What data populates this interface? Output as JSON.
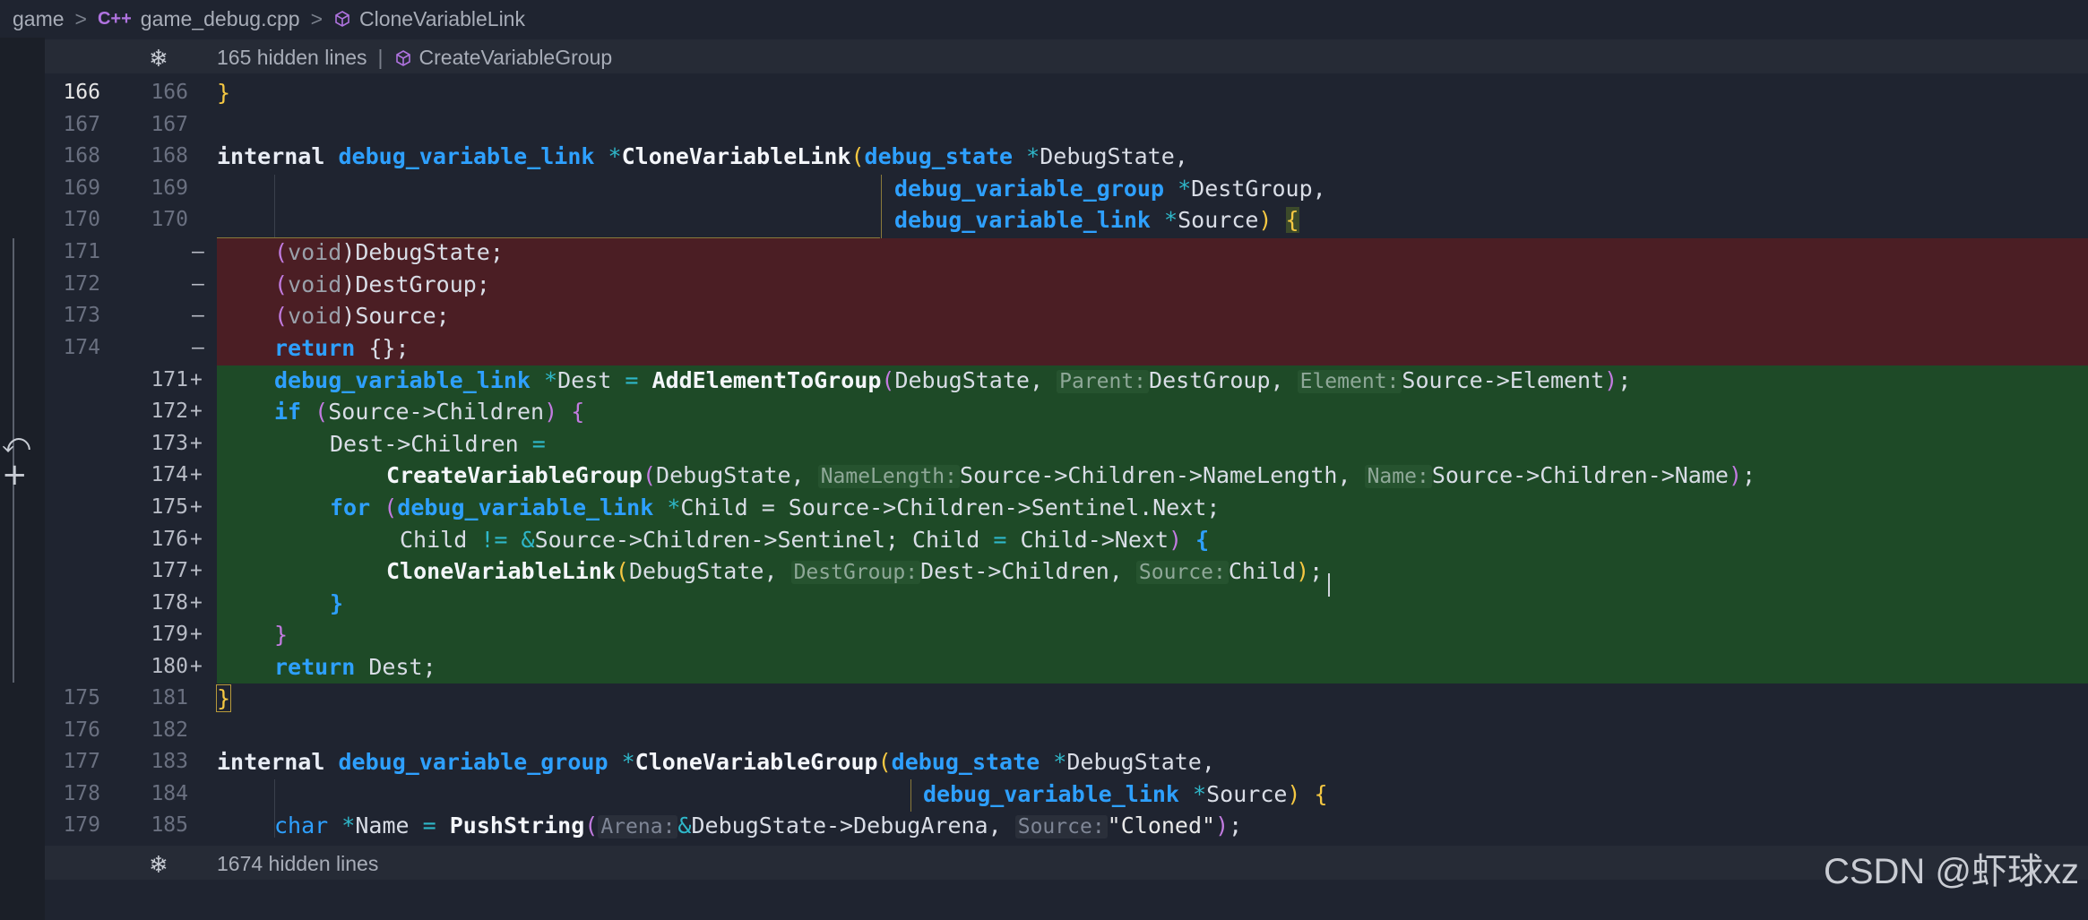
{
  "breadcrumb": {
    "root": "game",
    "cpp_icon": "C++",
    "file": "game_debug.cpp",
    "symbol": "CloneVariableLink"
  },
  "folds": {
    "top_text": "165 hidden lines",
    "top_symbol": "CreateVariableGroup",
    "bottom_text": "1674 hidden lines"
  },
  "lines": [
    {
      "l": "166",
      "r": "166",
      "m": ""
    },
    {
      "l": "167",
      "r": "167",
      "m": ""
    },
    {
      "l": "168",
      "r": "168",
      "m": ""
    },
    {
      "l": "169",
      "r": "169",
      "m": ""
    },
    {
      "l": "170",
      "r": "170",
      "m": ""
    },
    {
      "l": "171",
      "r": "",
      "m": "—"
    },
    {
      "l": "172",
      "r": "",
      "m": "—"
    },
    {
      "l": "173",
      "r": "",
      "m": "—"
    },
    {
      "l": "174",
      "r": "",
      "m": "—"
    },
    {
      "l": "",
      "r": "171",
      "m": "+"
    },
    {
      "l": "",
      "r": "172",
      "m": "+"
    },
    {
      "l": "",
      "r": "173",
      "m": "+"
    },
    {
      "l": "",
      "r": "174",
      "m": "+"
    },
    {
      "l": "",
      "r": "175",
      "m": "+"
    },
    {
      "l": "",
      "r": "176",
      "m": "+"
    },
    {
      "l": "",
      "r": "177",
      "m": "+"
    },
    {
      "l": "",
      "r": "178",
      "m": "+"
    },
    {
      "l": "",
      "r": "179",
      "m": "+"
    },
    {
      "l": "",
      "r": "180",
      "m": "+"
    },
    {
      "l": "175",
      "r": "181",
      "m": ""
    },
    {
      "l": "176",
      "r": "182",
      "m": ""
    },
    {
      "l": "177",
      "r": "183",
      "m": ""
    },
    {
      "l": "178",
      "r": "184",
      "m": ""
    },
    {
      "l": "179",
      "r": "185",
      "m": ""
    }
  ],
  "code": {
    "c0_brace": "}",
    "c2_internal": "internal",
    "c2_type": "debug_variable_link",
    "c2_star": "*",
    "c2_fn": "CloneVariableLink",
    "c2_open": "(",
    "c2_ptype": "debug_state",
    "c2_pstar": "*",
    "c2_pname": "DebugState,",
    "c3_ptype": "debug_variable_group",
    "c3_pstar": "*",
    "c3_pname": "DestGroup,",
    "c4_ptype": "debug_variable_link",
    "c4_pstar": "*",
    "c4_pname": "Source",
    "c4_close": ")",
    "c4_brace": "{",
    "d1_open": "(",
    "d1_void": "void",
    "d1_rest": ")DebugState;",
    "d2_open": "(",
    "d2_void": "void",
    "d2_rest": ")DestGroup;",
    "d3_open": "(",
    "d3_void": "void",
    "d3_rest": ")Source;",
    "d4_ret": "return",
    "d4_rest": "{};",
    "a1_type": "debug_variable_link",
    "a1_star": "*",
    "a1_var": "Dest",
    "a1_eq": "=",
    "a1_fn": "AddElementToGroup",
    "a1_open": "(",
    "a1_arg1": "DebugState,",
    "a1_h1": "Parent:",
    "a1_arg2": "DestGroup,",
    "a1_h2": "Element:",
    "a1_arg3": "Source->Element",
    "a1_close": ")",
    "a1_semi": ";",
    "a2_if": "if",
    "a2_open": "(",
    "a2_cond": "Source->Children",
    "a2_close": ")",
    "a2_brace": "{",
    "a3_text": "Dest->Children",
    "a3_eq": "=",
    "a4_fn": "CreateVariableGroup",
    "a4_open": "(",
    "a4_arg1": "DebugState,",
    "a4_h1": "NameLength:",
    "a4_arg2": "Source->Children->NameLength,",
    "a4_h2": "Name:",
    "a4_arg3": "Source->Children->Name",
    "a4_close": ")",
    "a4_semi": ";",
    "a5_for": "for",
    "a5_open": "(",
    "a5_type": "debug_variable_link",
    "a5_star": "*",
    "a5_rest": "Child = Source->Children->Sentinel.Next;",
    "a6_child": "Child",
    "a6_ne": "!=",
    "a6_amp": "&",
    "a6_rest": "Source->Children->Sentinel; Child",
    "a6_eq": "=",
    "a6_rest2": "Child->Next",
    "a6_close": ")",
    "a6_brace": "{",
    "a7_fn": "CloneVariableLink",
    "a7_open": "(",
    "a7_arg1": "DebugState,",
    "a7_h1": "DestGroup:",
    "a7_arg2": "Dest->Children,",
    "a7_h2": "Source:",
    "a7_arg3": "Child",
    "a7_close": ")",
    "a7_semi": ";",
    "a8_brace": "}",
    "a9_brace": "}",
    "a10_ret": "return",
    "a10_rest": "Dest;",
    "b0_brace": "}",
    "b2_internal": "internal",
    "b2_type": "debug_variable_group",
    "b2_star": "*",
    "b2_fn": "CloneVariableGroup",
    "b2_open": "(",
    "b2_ptype": "debug_state",
    "b2_pstar": "*",
    "b2_pname": "DebugState,",
    "b3_ptype": "debug_variable_link",
    "b3_pstar": "*",
    "b3_pname": "Source",
    "b3_close": ")",
    "b3_brace": "{",
    "b4_type": "char",
    "b4_star": "*",
    "b4_var": "Name",
    "b4_eq": "=",
    "b4_fn": "PushString",
    "b4_open": "(",
    "b4_h1": "Arena:",
    "b4_amp": "&",
    "b4_arg1": "DebugState->DebugArena,",
    "b4_h2": "Source:",
    "b4_str": "\"Cloned\"",
    "b4_close": ")",
    "b4_semi": ";"
  },
  "watermark": "CSDN @虾球xz"
}
